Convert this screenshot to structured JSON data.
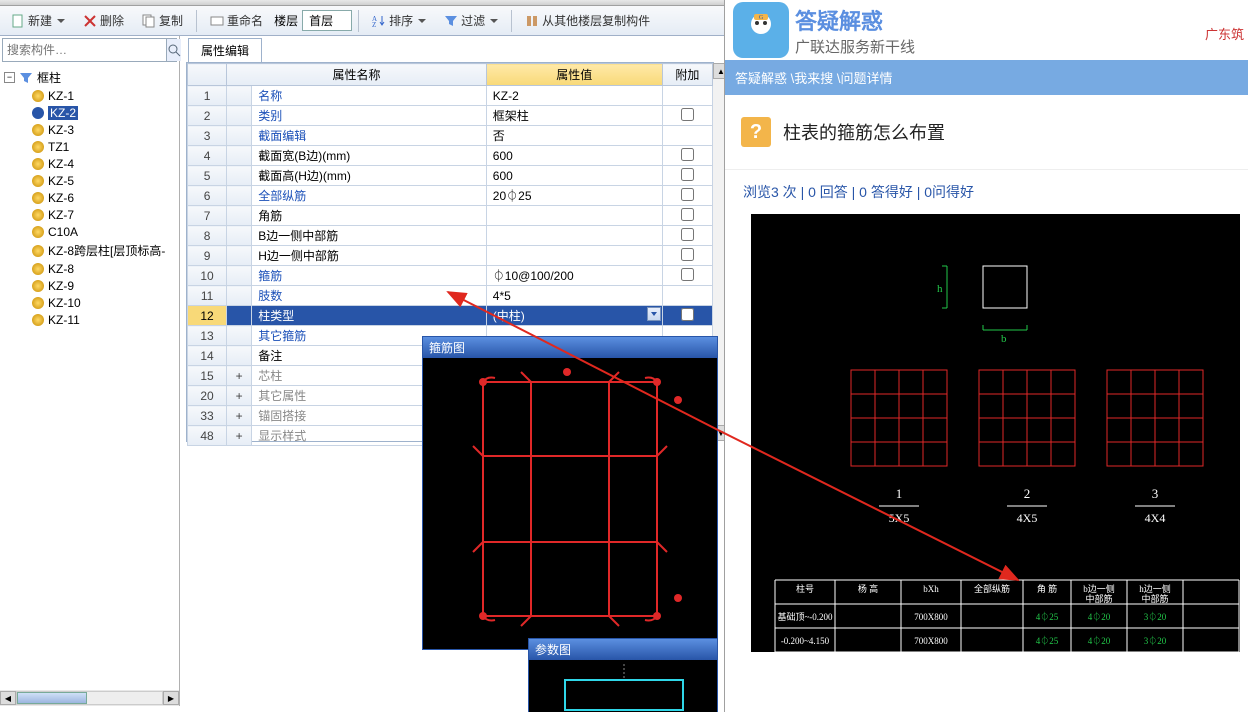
{
  "toolbar": {
    "new": "新建",
    "delete": "删除",
    "copy": "复制",
    "rename": "重命名",
    "floor_label": "楼层",
    "floor_value": "首层",
    "sort": "排序",
    "filter": "过滤",
    "copy_from_floor": "从其他楼层复制构件"
  },
  "search": {
    "placeholder": "搜索构件…"
  },
  "tree": {
    "root": "框柱",
    "items": [
      "KZ-1",
      "KZ-2",
      "KZ-3",
      "TZ1",
      "KZ-4",
      "KZ-5",
      "KZ-6",
      "KZ-7",
      "C10A",
      "KZ-8跨层柱[层顶标高-",
      "KZ-8",
      "KZ-9",
      "KZ-10",
      "KZ-11"
    ],
    "selected_index": 1
  },
  "prop_tab": "属性编辑",
  "prop_headers": {
    "name": "属性名称",
    "value": "属性值",
    "extra": "附加"
  },
  "prop_rows": [
    {
      "n": "1",
      "name": "名称",
      "val": "KZ-2",
      "blue": true,
      "chk": false
    },
    {
      "n": "2",
      "name": "类别",
      "val": "框架柱",
      "blue": true,
      "chk": true
    },
    {
      "n": "3",
      "name": "截面编辑",
      "val": "否",
      "blue": true,
      "chk": false
    },
    {
      "n": "4",
      "name": "截面宽(B边)(mm)",
      "val": "600",
      "blue": false,
      "chk": true
    },
    {
      "n": "5",
      "name": "截面高(H边)(mm)",
      "val": "600",
      "blue": false,
      "chk": true
    },
    {
      "n": "6",
      "name": "全部纵筋",
      "val": "20⏀25",
      "blue": true,
      "chk": true
    },
    {
      "n": "7",
      "name": "角筋",
      "val": "",
      "blue": false,
      "chk": true
    },
    {
      "n": "8",
      "name": "B边一侧中部筋",
      "val": "",
      "blue": false,
      "chk": true
    },
    {
      "n": "9",
      "name": "H边一侧中部筋",
      "val": "",
      "blue": false,
      "chk": true
    },
    {
      "n": "10",
      "name": "箍筋",
      "val": "⏀10@100/200",
      "blue": true,
      "chk": true
    },
    {
      "n": "11",
      "name": "肢数",
      "val": "4*5",
      "blue": true,
      "chk": false
    },
    {
      "n": "12",
      "name": "柱类型",
      "val": "(中柱)",
      "blue": false,
      "chk": true,
      "sel": true,
      "dd": true
    },
    {
      "n": "13",
      "name": "其它箍筋",
      "val": "",
      "blue": true,
      "chk": false
    },
    {
      "n": "14",
      "name": "备注",
      "val": "",
      "blue": false,
      "chk": true
    },
    {
      "n": "15",
      "name": "芯柱",
      "val": "",
      "blue": false,
      "chk": false,
      "grp": true
    },
    {
      "n": "20",
      "name": "其它属性",
      "val": "",
      "blue": false,
      "chk": false,
      "grp": true
    },
    {
      "n": "33",
      "name": "锚固搭接",
      "val": "",
      "blue": false,
      "chk": false,
      "grp": true
    },
    {
      "n": "48",
      "name": "显示样式",
      "val": "",
      "blue": false,
      "chk": false,
      "grp": true
    }
  ],
  "stirrup_title": "箍筋图",
  "param_title": "参数图",
  "browser": {
    "logo_line1": "答疑解惑",
    "logo_line2": "广联达服务新干线",
    "region": "广东筑",
    "crumb": "答疑解惑 \\我来搜 \\问题详情",
    "question": "柱表的箍筋怎么布置",
    "stats": "浏览3 次 | 0 回答 | 0 答得好 | 0问得好",
    "cad": {
      "dims": [
        "h",
        "b"
      ],
      "sections": [
        {
          "num": "1",
          "label": "5X5"
        },
        {
          "num": "2",
          "label": "4X5"
        },
        {
          "num": "3",
          "label": "4X4"
        }
      ],
      "table_headers": [
        "柱号",
        "杨 高",
        "bXh",
        "全部纵筋",
        "角 筋",
        "b边一侧\\n中部筋",
        "h边一侧\\n中部筋"
      ],
      "table_rows": [
        [
          "基础顶~-0.200",
          "",
          "700X800",
          "",
          "4⏀25",
          "4⏀20",
          "3⏀20"
        ],
        [
          "-0.200~4.150",
          "",
          "700X800",
          "",
          "4⏀25",
          "4⏀20",
          "3⏀20"
        ]
      ]
    }
  }
}
